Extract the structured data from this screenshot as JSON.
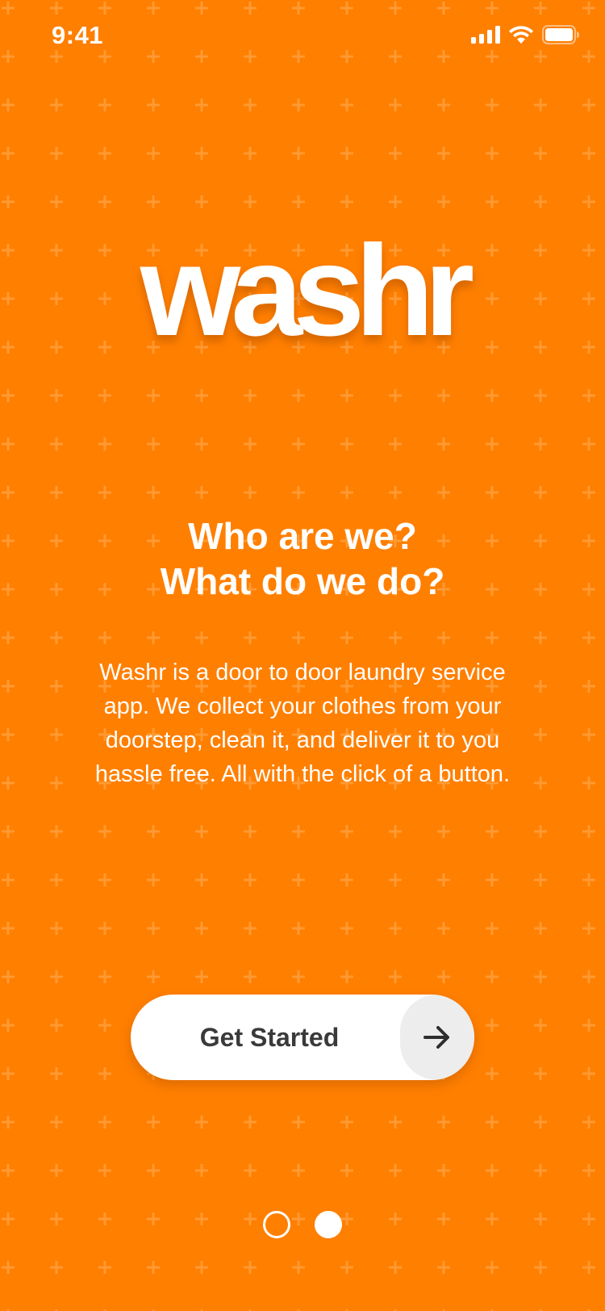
{
  "status_bar": {
    "time": "9:41",
    "icons": [
      "cellular-signal-icon",
      "wifi-icon",
      "battery-icon"
    ]
  },
  "logo": {
    "text": "washr"
  },
  "headline": {
    "line1": "Who are we?",
    "line2": "What do we do?"
  },
  "description": "Washr is a door to door laundry service app. We collect your clothes from your doorstep, clean it, and deliver it to you hassle free. All with the click of a button.",
  "cta": {
    "label": "Get Started",
    "icon": "arrow-right-icon"
  },
  "pager": {
    "total": 2,
    "current": 2
  },
  "colors": {
    "background": "#FF7F00",
    "pattern": "#FF9A33",
    "text": "#FFFFFF",
    "button": "#FFFFFF",
    "button_text": "#3A3A3A",
    "arrow_bg": "#EDEDED"
  }
}
